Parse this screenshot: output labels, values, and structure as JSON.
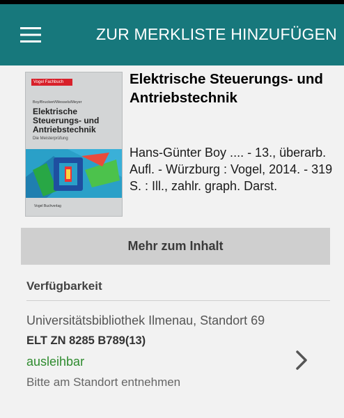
{
  "appbar": {
    "menu_icon": "hamburger-menu-icon",
    "action_label": "ZUR MERKLISTE HINZUFÜGEN",
    "color": "#17787c"
  },
  "cover": {
    "series": "Vogel Fachbuch",
    "authors": "Boy/Bruckert/Wessels/Meyer",
    "title_line1": "Elektrische",
    "title_line2": "Steuerungs- und",
    "title_line3": "Antriebstechnik",
    "subtitle": "Die Meisterprüfung",
    "publisher": "Vogel Buchverlag"
  },
  "book": {
    "title": "Elektrische Steuerungs- und Antriebstechnik",
    "meta": "Hans-Günter Boy .... - 13., überarb. Aufl. - Würzburg : Vogel, 2014. - 319 S. : Ill., zahlr. graph. Darst."
  },
  "more_button": {
    "label": "Mehr zum Inhalt"
  },
  "availability": {
    "section_title": "Verfügbarkeit",
    "library": "Universitätsbibliothek Ilmenau, Standort 69",
    "shelfmark": "ELT ZN 8285 B789(13)",
    "status": "ausleihbar",
    "status_color": "#2e8b2e",
    "note": "Bitte am Standort entnehmen",
    "chevron_icon": "chevron-right-icon"
  }
}
